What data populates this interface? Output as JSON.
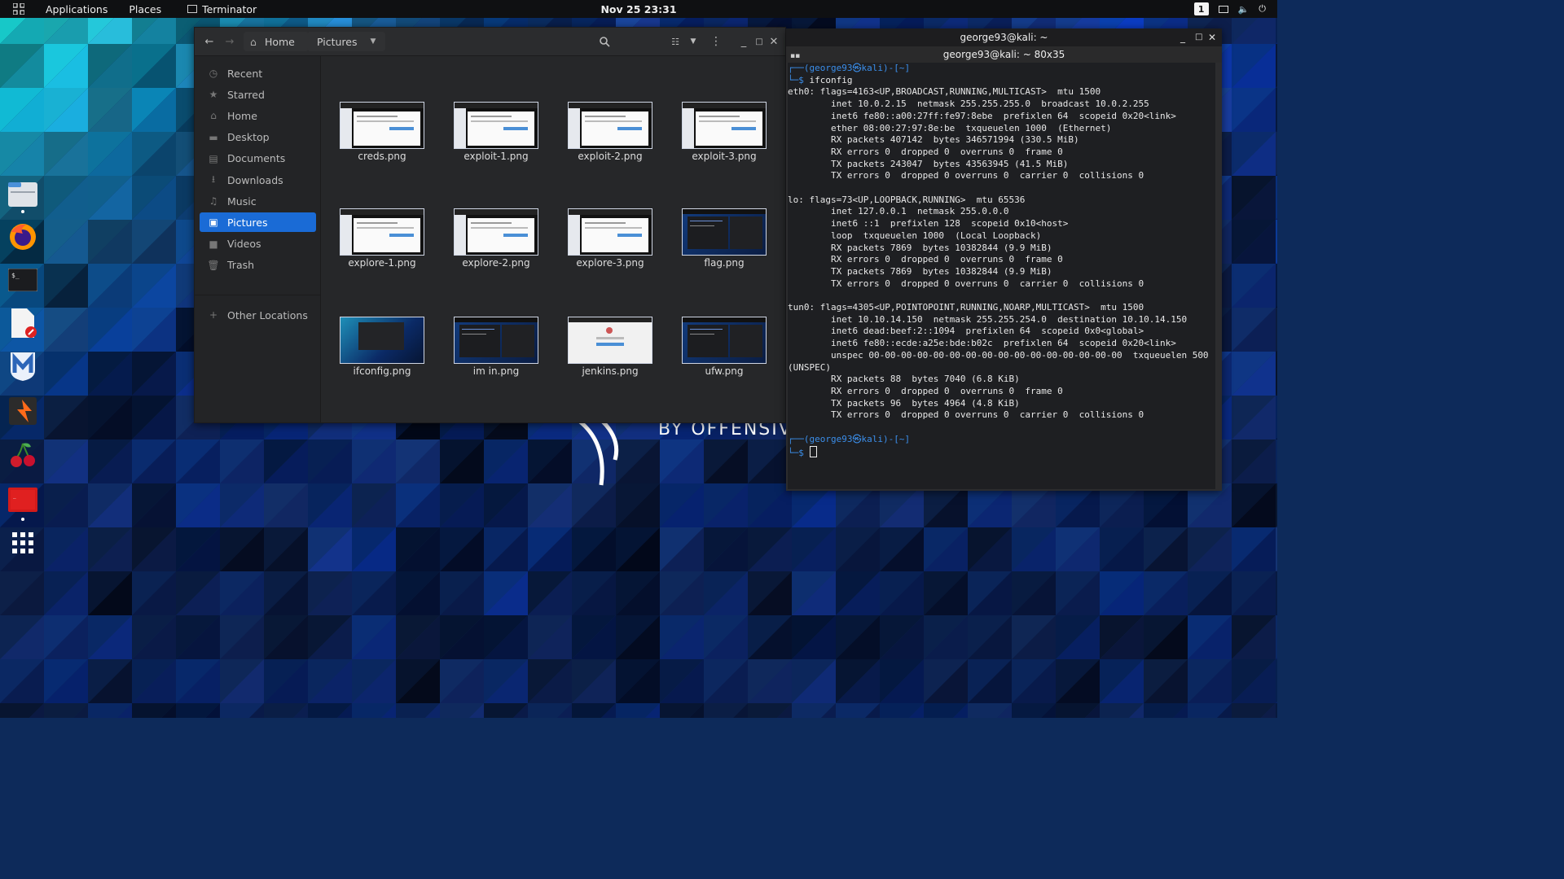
{
  "topbar": {
    "applications": "Applications",
    "places": "Places",
    "active_app": "Terminator",
    "datetime": "Nov 25  23:31",
    "workspace": "1"
  },
  "wallpaper_text": "BY OFFENSIVE SECURITY",
  "dock": [
    {
      "name": "files-icon"
    },
    {
      "name": "firefox-icon"
    },
    {
      "name": "terminal-icon"
    },
    {
      "name": "text-editor-icon"
    },
    {
      "name": "metasploit-icon"
    },
    {
      "name": "burpsuite-icon"
    },
    {
      "name": "cherrytree-icon"
    },
    {
      "name": "terminator-icon"
    },
    {
      "name": "show-apps-icon"
    }
  ],
  "file_manager": {
    "breadcrumb": {
      "home": "Home",
      "current": "Pictures"
    },
    "sidebar": [
      {
        "label": "Recent",
        "icon": "clock-icon",
        "glyph": "◷"
      },
      {
        "label": "Starred",
        "icon": "star-icon",
        "glyph": "★"
      },
      {
        "label": "Home",
        "icon": "home-icon",
        "glyph": "⌂"
      },
      {
        "label": "Desktop",
        "icon": "desktop-icon",
        "glyph": "▬"
      },
      {
        "label": "Documents",
        "icon": "document-icon",
        "glyph": "▤"
      },
      {
        "label": "Downloads",
        "icon": "download-icon",
        "glyph": "⭳"
      },
      {
        "label": "Music",
        "icon": "music-icon",
        "glyph": "♫"
      },
      {
        "label": "Pictures",
        "icon": "pictures-icon",
        "glyph": "▣",
        "active": true
      },
      {
        "label": "Videos",
        "icon": "video-icon",
        "glyph": "■"
      },
      {
        "label": "Trash",
        "icon": "trash-icon",
        "glyph": "🗑"
      },
      {
        "label": "Other Locations",
        "icon": "plus-icon",
        "glyph": "+"
      }
    ],
    "files": [
      {
        "name": "creds.png",
        "style": "light"
      },
      {
        "name": "exploit-1.png",
        "style": "light"
      },
      {
        "name": "exploit-2.png",
        "style": "light"
      },
      {
        "name": "exploit-3.png",
        "style": "light"
      },
      {
        "name": "explore-1.png",
        "style": "light"
      },
      {
        "name": "explore-2.png",
        "style": "light"
      },
      {
        "name": "explore-3.png",
        "style": "light"
      },
      {
        "name": "flag.png",
        "style": "dark"
      },
      {
        "name": "ifconfig.png",
        "style": "desktop"
      },
      {
        "name": "im in.png",
        "style": "dark"
      },
      {
        "name": "jenkins.png",
        "style": "login"
      },
      {
        "name": "ufw.png",
        "style": "dark"
      }
    ]
  },
  "terminal": {
    "title": "george93@kali: ~",
    "subtitle": "george93@kali: ~ 80x35",
    "prompt_top": "┌──(george93㉿kali)-[~]",
    "prompt_bottom": "└─$ ",
    "command": "ifconfig",
    "output": [
      "eth0: flags=4163<UP,BROADCAST,RUNNING,MULTICAST>  mtu 1500",
      "        inet 10.0.2.15  netmask 255.255.255.0  broadcast 10.0.2.255",
      "        inet6 fe80::a00:27ff:fe97:8ebe  prefixlen 64  scopeid 0x20<link>",
      "        ether 08:00:27:97:8e:be  txqueuelen 1000  (Ethernet)",
      "        RX packets 407142  bytes 346571994 (330.5 MiB)",
      "        RX errors 0  dropped 0  overruns 0  frame 0",
      "        TX packets 243047  bytes 43563945 (41.5 MiB)",
      "        TX errors 0  dropped 0 overruns 0  carrier 0  collisions 0",
      "",
      "lo: flags=73<UP,LOOPBACK,RUNNING>  mtu 65536",
      "        inet 127.0.0.1  netmask 255.0.0.0",
      "        inet6 ::1  prefixlen 128  scopeid 0x10<host>",
      "        loop  txqueuelen 1000  (Local Loopback)",
      "        RX packets 7869  bytes 10382844 (9.9 MiB)",
      "        RX errors 0  dropped 0  overruns 0  frame 0",
      "        TX packets 7869  bytes 10382844 (9.9 MiB)",
      "        TX errors 0  dropped 0 overruns 0  carrier 0  collisions 0",
      "",
      "tun0: flags=4305<UP,POINTOPOINT,RUNNING,NOARP,MULTICAST>  mtu 1500",
      "        inet 10.10.14.150  netmask 255.255.254.0  destination 10.10.14.150",
      "        inet6 dead:beef:2::1094  prefixlen 64  scopeid 0x0<global>",
      "        inet6 fe80::ecde:a25e:bde:b02c  prefixlen 64  scopeid 0x20<link>",
      "        unspec 00-00-00-00-00-00-00-00-00-00-00-00-00-00-00-00  txqueuelen 500",
      "(UNSPEC)",
      "        RX packets 88  bytes 7040 (6.8 KiB)",
      "        RX errors 0  dropped 0  overruns 0  frame 0",
      "        TX packets 96  bytes 4964 (4.8 KiB)",
      "        TX errors 0  dropped 0 overruns 0  carrier 0  collisions 0",
      ""
    ]
  },
  "colors": {
    "accent": "#1a6bd6",
    "prompt": "#3b8eea",
    "terminal_bg": "#1e1f22",
    "topbar_bg": "#0f1012"
  }
}
